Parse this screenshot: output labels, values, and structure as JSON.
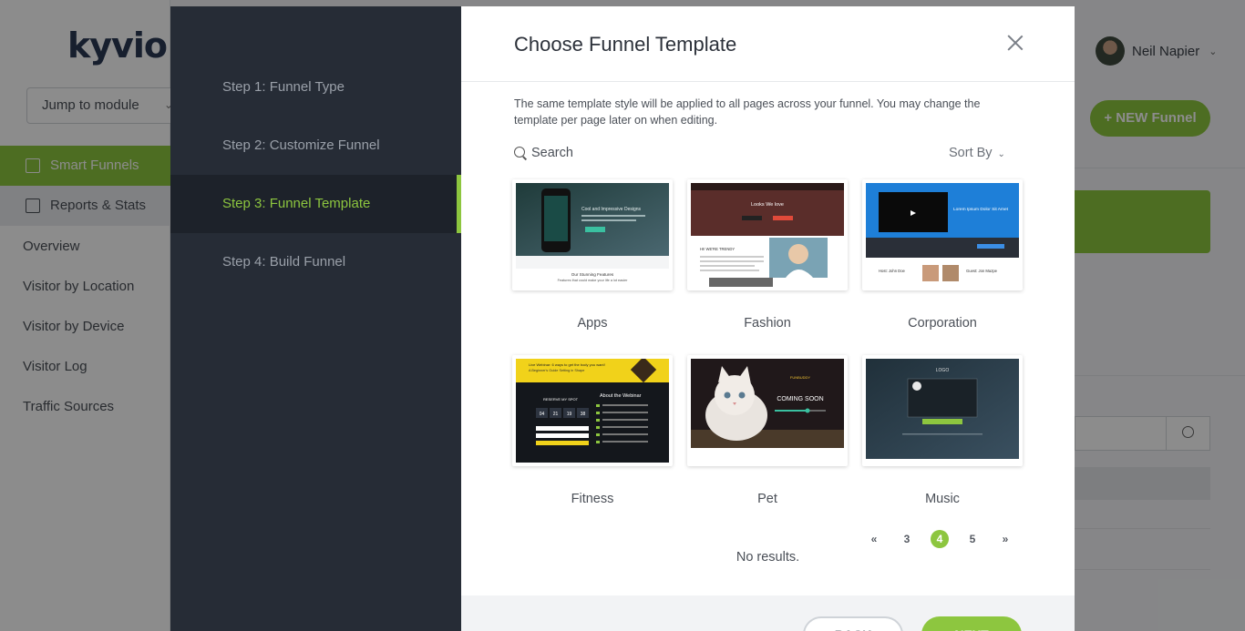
{
  "app": {
    "logo": "kyvio",
    "jump_to_module": "Jump to module",
    "nav": {
      "smart_funnels": "Smart Funnels",
      "reports_stats": "Reports & Stats",
      "sub_items": [
        "Overview",
        "Visitor by Location",
        "Visitor by Device",
        "Visitor Log",
        "Traffic Sources"
      ]
    },
    "user": {
      "name": "Neil Napier"
    },
    "new_funnel": "+ NEW Funnel"
  },
  "modal": {
    "steps": [
      "Step 1: Funnel Type",
      "Step 2: Customize Funnel",
      "Step 3: Funnel Template",
      "Step 4: Build Funnel"
    ],
    "current_step_index": 2,
    "title": "Choose Funnel Template",
    "description": "The same template style will be applied to all pages across your funnel. You may change the template per page later on when editing.",
    "search_label": "Search",
    "sort_label": "Sort By",
    "templates": [
      {
        "name": "Apps",
        "thumb": {
          "headline": "Cool and Impressive Designs",
          "footer_line1": "Our Stunning Features",
          "footer_line2": "Features that could make your life a lot easier"
        }
      },
      {
        "name": "Fashion",
        "thumb": {
          "headline": "Looks We love",
          "subline": "HI! WE'RE TRENDY"
        }
      },
      {
        "name": "Corporation",
        "thumb": {
          "headline": "Lorem Ipsum Dolor Sit Amet",
          "person1": "Host: John Doe",
          "person2": "Guest: Jon Mazpe"
        }
      },
      {
        "name": "Fitness",
        "thumb": {
          "headline": "Live Webinar: 6 ways to get the body you want!",
          "subline": "A Beginner's Guide Setting in Shape",
          "about": "About the Webinar",
          "reserve": "RESERVE MY SPOT",
          "countdown": [
            "04",
            "21",
            "19",
            "38"
          ]
        }
      },
      {
        "name": "Pet",
        "thumb": {
          "brand": "FUNBUDDY",
          "headline": "COMING SOON"
        }
      },
      {
        "name": "Music",
        "thumb": {
          "logo": "LOGO"
        }
      }
    ],
    "pagination": {
      "prev": "«",
      "pages": [
        "3",
        "4",
        "5"
      ],
      "active_page": "4",
      "next": "»"
    },
    "no_results": "No results.",
    "back_label": "BACK",
    "next_label": "NEXT"
  },
  "colors": {
    "accent": "#8dc63f",
    "steps_bg": "#262c36",
    "steps_active_bg": "#1d222a"
  }
}
